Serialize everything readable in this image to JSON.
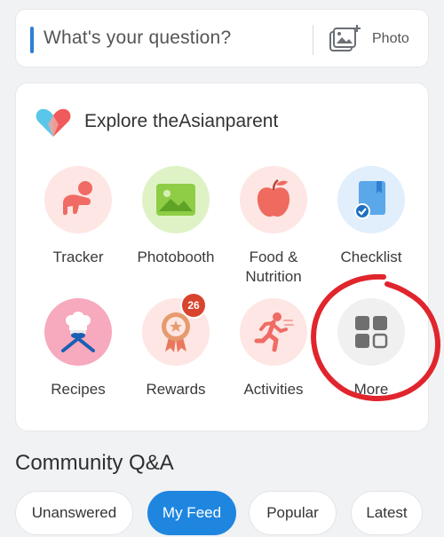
{
  "ask": {
    "placeholder": "What's your question?",
    "photo_label": "Photo",
    "photo_icon": "photo-add-icon",
    "accent_color": "#2d7fd3"
  },
  "explore": {
    "title": "Explore theAsianparent",
    "logo_icon": "heart-logo-icon",
    "items": [
      {
        "label": "Tracker",
        "icon": "baby-crawling-icon"
      },
      {
        "label": "Photobooth",
        "icon": "image-icon"
      },
      {
        "label": "Food &\nNutrition",
        "icon": "apple-icon"
      },
      {
        "label": "Checklist",
        "icon": "checklist-book-icon"
      },
      {
        "label": "Recipes",
        "icon": "chef-hat-utensils-icon"
      },
      {
        "label": "Rewards",
        "icon": "medal-icon",
        "badge": "26"
      },
      {
        "label": "Activities",
        "icon": "running-person-icon"
      },
      {
        "label": "More",
        "icon": "grid-icon"
      }
    ]
  },
  "community": {
    "title": "Community Q&A",
    "tabs": [
      {
        "label": "Unanswered",
        "active": false
      },
      {
        "label": "My Feed",
        "active": true
      },
      {
        "label": "Popular",
        "active": false
      },
      {
        "label": "Latest",
        "active": false
      }
    ]
  },
  "colors": {
    "primary": "#1f86e0",
    "badge": "#d8442e",
    "annotation": "#e0252d"
  }
}
